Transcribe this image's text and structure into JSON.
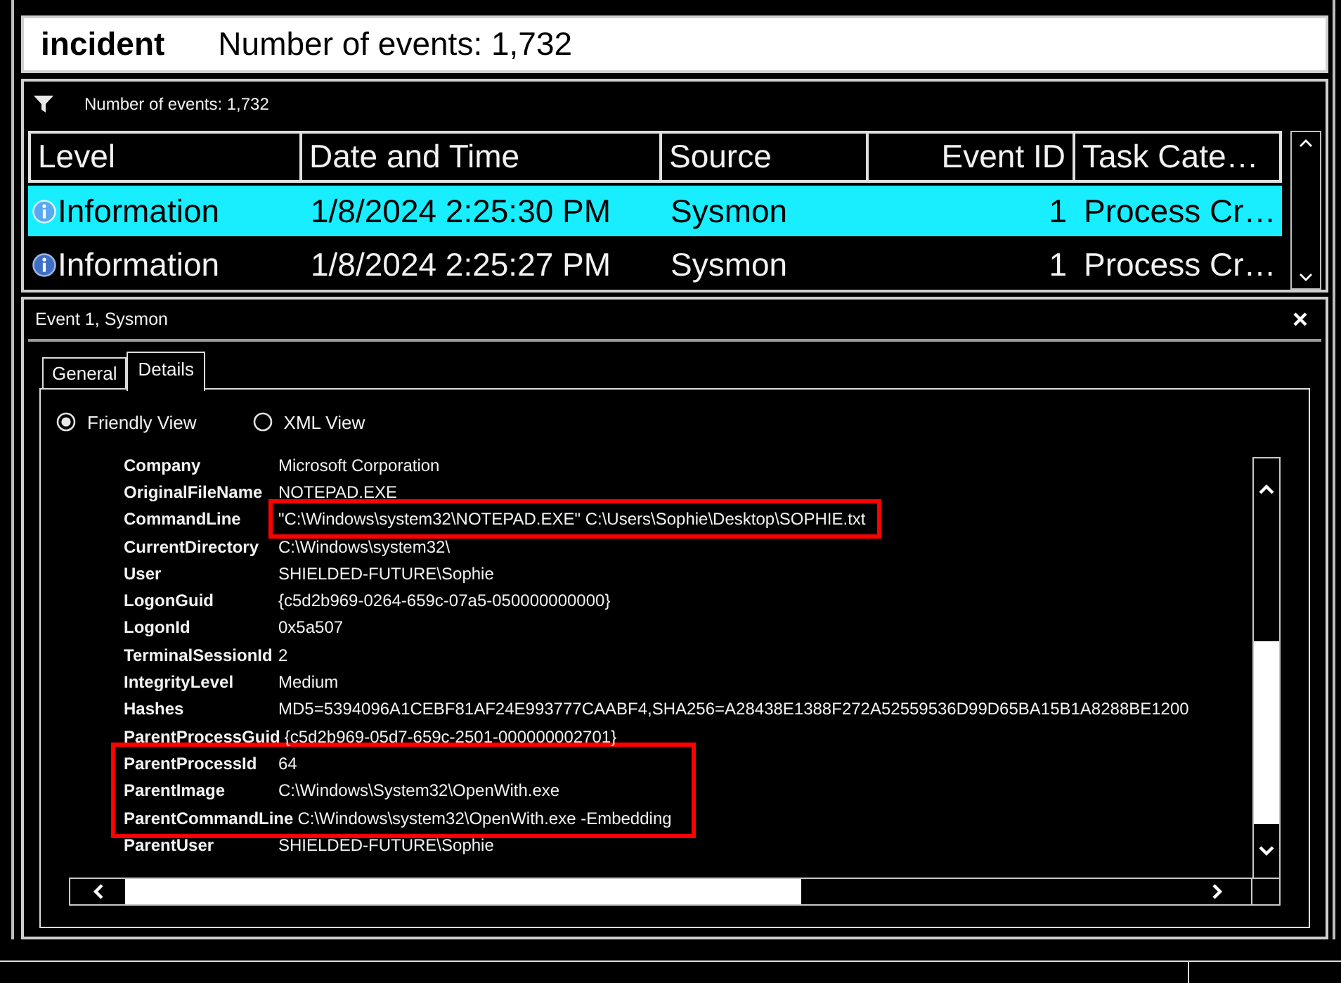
{
  "header": {
    "title": "incident",
    "event_count": "Number of events: 1,732"
  },
  "events": {
    "filter_label": "Number of events: 1,732",
    "table": {
      "columns": [
        {
          "label": "Level",
          "kind": "level"
        },
        {
          "label": "Date and Time",
          "kind": "text"
        },
        {
          "label": "Source",
          "kind": "text"
        },
        {
          "label": "Event ID",
          "kind": "number"
        },
        {
          "label": "Task Cate…",
          "kind": "text"
        }
      ],
      "rows": [
        {
          "selected": true,
          "cells": [
            "Information",
            "1/8/2024 2:25:30 PM",
            "Sysmon",
            "1",
            "Process Cr…"
          ]
        },
        {
          "selected": false,
          "cells": [
            "Information",
            "1/8/2024 2:25:27 PM",
            "Sysmon",
            "1",
            "Process Cr…"
          ]
        }
      ]
    }
  },
  "details": {
    "title": "Event 1, Sysmon",
    "tabs": [
      {
        "label": "General",
        "selected": false
      },
      {
        "label": "Details",
        "selected": true
      }
    ],
    "views": [
      {
        "label": "Friendly View",
        "selected": true
      },
      {
        "label": "XML View",
        "selected": false
      }
    ],
    "fields": [
      {
        "name": "Company",
        "value": "Microsoft Corporation",
        "value_highlighted": false,
        "row_highlighted": false
      },
      {
        "name": "OriginalFileName",
        "value": "NOTEPAD.EXE",
        "value_highlighted": false,
        "row_highlighted": false
      },
      {
        "name": "CommandLine",
        "value": "\"C:\\Windows\\system32\\NOTEPAD.EXE\" C:\\Users\\Sophie\\Desktop\\SOPHIE.txt",
        "value_highlighted": true,
        "row_highlighted": false
      },
      {
        "name": "CurrentDirectory",
        "value": "C:\\Windows\\system32\\",
        "value_highlighted": false,
        "row_highlighted": false
      },
      {
        "name": "User",
        "value": "SHIELDED-FUTURE\\Sophie",
        "value_highlighted": false,
        "row_highlighted": false
      },
      {
        "name": "LogonGuid",
        "value": "{c5d2b969-0264-659c-07a5-050000000000}",
        "value_highlighted": false,
        "row_highlighted": false
      },
      {
        "name": "LogonId",
        "value": "0x5a507",
        "value_highlighted": false,
        "row_highlighted": false
      },
      {
        "name": "TerminalSessionId",
        "value": "2",
        "value_highlighted": false,
        "row_highlighted": false
      },
      {
        "name": "IntegrityLevel",
        "value": "Medium",
        "value_highlighted": false,
        "row_highlighted": false
      },
      {
        "name": "Hashes",
        "value": "MD5=5394096A1CEBF81AF24E993777CAABF4,SHA256=A28438E1388F272A52559536D99D65BA15B1A8288BE1200",
        "value_highlighted": false,
        "row_highlighted": false
      },
      {
        "name": "ParentProcessGuid",
        "value": "{c5d2b969-05d7-659c-2501-000000002701}",
        "value_highlighted": false,
        "row_highlighted": false
      },
      {
        "name": "ParentProcessId",
        "value": "64",
        "value_highlighted": false,
        "row_highlighted": true
      },
      {
        "name": "ParentImage",
        "value": "C:\\Windows\\System32\\OpenWith.exe",
        "value_highlighted": false,
        "row_highlighted": true
      },
      {
        "name": "ParentCommandLine",
        "value": "C:\\Windows\\system32\\OpenWith.exe -Embedding",
        "value_highlighted": false,
        "row_highlighted": true
      },
      {
        "name": "ParentUser",
        "value": "SHIELDED-FUTURE\\Sophie",
        "value_highlighted": false,
        "row_highlighted": false
      }
    ]
  }
}
